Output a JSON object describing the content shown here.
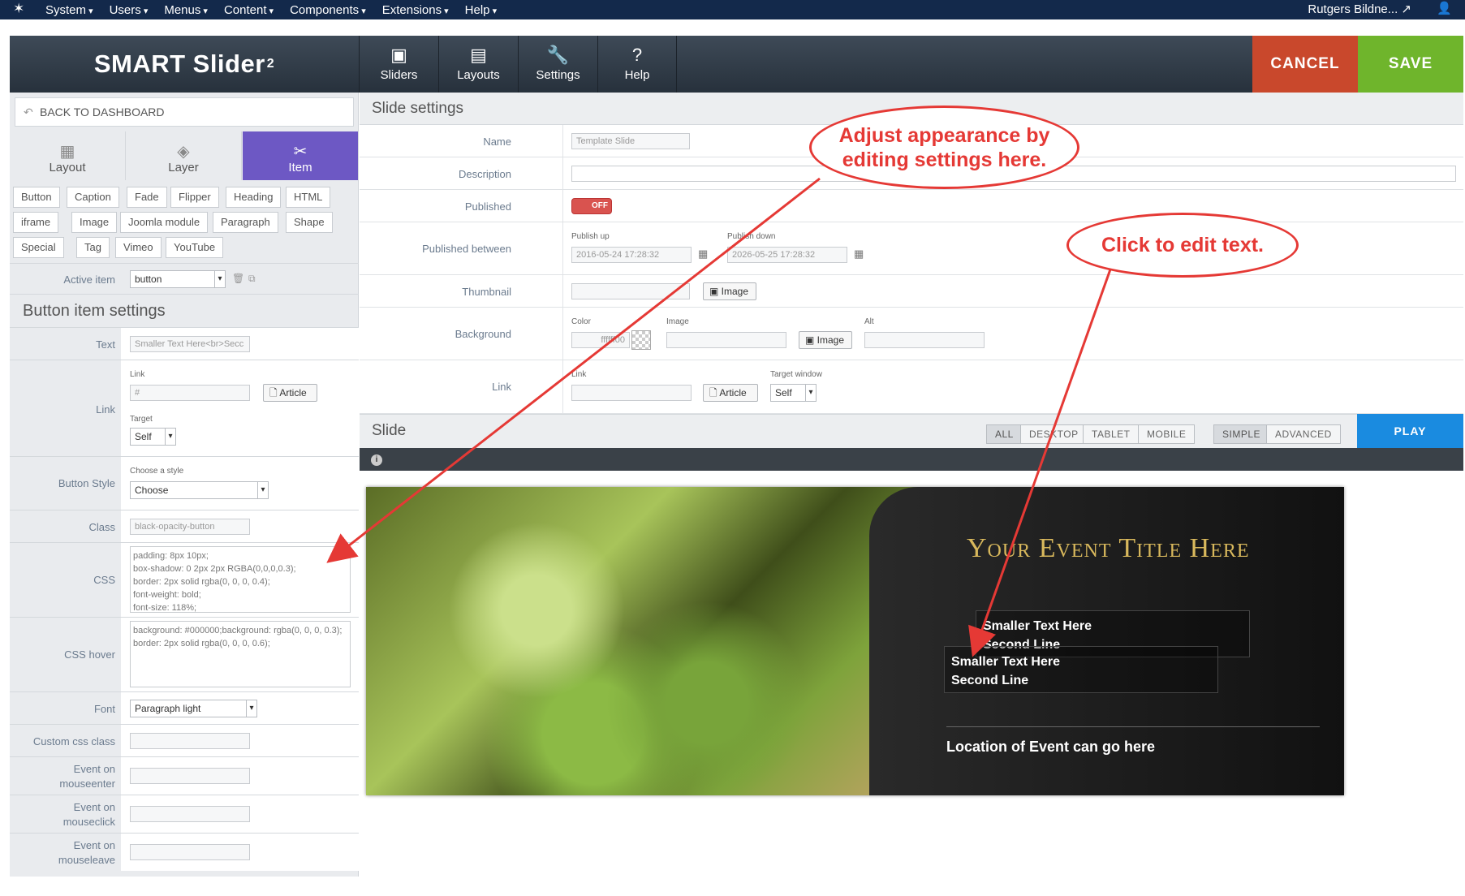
{
  "topbar": {
    "menu": [
      "System",
      "Users",
      "Menus",
      "Content",
      "Components",
      "Extensions",
      "Help"
    ],
    "user": "Rutgers Bildne... ↗"
  },
  "header": {
    "brand": "SMART Slider",
    "brand_sup": "2",
    "nav": [
      {
        "label": "Sliders",
        "icon": "image-icon"
      },
      {
        "label": "Layouts",
        "icon": "layouts-icon"
      },
      {
        "label": "Settings",
        "icon": "wrench-icon"
      },
      {
        "label": "Help",
        "icon": "help-icon"
      }
    ],
    "cancel": "CANCEL",
    "save": "SAVE"
  },
  "left": {
    "back": "BACK TO DASHBOARD",
    "tabs": [
      "Layout",
      "Layer",
      "Item"
    ],
    "item_types": [
      "Button",
      "Caption",
      "Fade",
      "Flipper",
      "Heading",
      "HTML",
      "iframe",
      "Image",
      "Joomla module",
      "Paragraph",
      "Shape",
      "Special",
      "Tag",
      "Vimeo",
      "YouTube"
    ],
    "active_item_label": "Active item",
    "active_item_value": "button",
    "section_title": "Button item settings",
    "text_label": "Text",
    "text_value": "Smaller Text Here<br>Secc",
    "link_label": "Link",
    "link_sub": "Link",
    "link_value": "#",
    "article": "Article",
    "target_sub": "Target",
    "target_value": "Self",
    "style_label": "Button Style",
    "style_sub": "Choose a style",
    "style_value": "Choose",
    "class_label": "Class",
    "class_value": "black-opacity-button",
    "css_label": "CSS",
    "css_value": "padding: 8px 10px;\nbox-shadow: 0 2px 2px RGBA(0,0,0,0.3);\nborder: 2px solid rgba(0, 0, 0, 0.4);\nfont-weight: bold;\nfont-size: 118%;",
    "csshover_label": "CSS hover",
    "csshover_value": "background: #000000;background: rgba(0, 0, 0, 0.3);\nborder: 2px solid rgba(0, 0, 0, 0.6);",
    "font_label": "Font",
    "font_value": "Paragraph light",
    "customcss_label": "Custom css class",
    "ev_enter_1": "Event on",
    "ev_enter_2": "mouseenter",
    "ev_click_1": "Event on",
    "ev_click_2": "mouseclick",
    "ev_leave_1": "Event on",
    "ev_leave_2": "mouseleave"
  },
  "right": {
    "title": "Slide settings",
    "name_label": "Name",
    "name_value": "Template Slide",
    "desc_label": "Description",
    "published_label": "Published",
    "published_value": "OFF",
    "between_label": "Published between",
    "pub_up_label": "Publish up",
    "pub_up_value": "2016-05-24 17:28:32",
    "pub_down_label": "Publish down",
    "pub_down_value": "2026-05-25 17:28:32",
    "thumb_label": "Thumbnail",
    "image_btn": "Image",
    "bg_label": "Background",
    "color_label": "Color",
    "color_value": "ffffff00",
    "image_label": "Image",
    "alt_label": "Alt",
    "link_label": "Link",
    "link_sub": "Link",
    "article_btn": "Article",
    "target_label": "Target window",
    "target_value": "Self",
    "slide_title": "Slide",
    "devices": [
      "ALL",
      "DESKTOP",
      "TABLET",
      "MOBILE"
    ],
    "modes": [
      "SIMPLE",
      "ADVANCED"
    ],
    "play": "PLAY",
    "info": "i"
  },
  "slide": {
    "title": "Your Event Title Here",
    "box1_l1": "Smaller Text Here",
    "box1_l2": "Second Line",
    "box2_l1": "Smaller Text Here",
    "box2_l2": "Second Line",
    "location": "Location of Event can go here"
  },
  "annotations": {
    "a1": "Adjust appearance by editing settings here.",
    "a2": "Click to edit text."
  },
  "colors": {
    "topbar": "#13294b",
    "cancel": "#c9482c",
    "save": "#6fb52c",
    "active_tab": "#6d58c4",
    "play": "#1a8be0",
    "annotation": "#e53935"
  }
}
